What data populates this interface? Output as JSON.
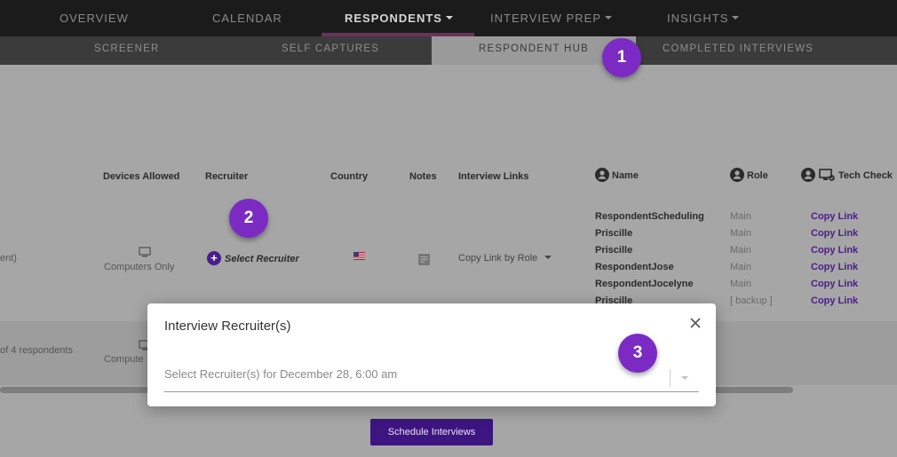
{
  "topnav": {
    "items": [
      {
        "label": "OVERVIEW"
      },
      {
        "label": "CALENDAR"
      },
      {
        "label": "RESPONDENTS"
      },
      {
        "label": "INTERVIEW PREP"
      },
      {
        "label": "INSIGHTS"
      }
    ],
    "active": "RESPONDENTS",
    "accent": "#6e2f5c"
  },
  "subnav": {
    "items": [
      {
        "label": "SCREENER"
      },
      {
        "label": "SELF CAPTURES"
      },
      {
        "label": "RESPONDENT HUB"
      },
      {
        "label": "COMPLETED INTERVIEWS"
      }
    ],
    "active": "RESPONDENT HUB"
  },
  "table": {
    "headers": {
      "devices": "Devices Allowed",
      "recruiter": "Recruiter",
      "country": "Country",
      "notes": "Notes",
      "interview_links": "Interview Links",
      "name": "Name",
      "role": "Role",
      "tech_check": "Tech Check"
    },
    "row1": {
      "left_fragment": "ent)",
      "devices": "Computers Only",
      "recruiter_action": "Select Recruiter",
      "country_flag": "flag-us-icon",
      "interview_links": "Copy Link by Role",
      "respondents": [
        {
          "name": "RespondentScheduling",
          "role": "Main",
          "link": "Copy Link"
        },
        {
          "name": "Priscille",
          "role": "Main",
          "link": "Copy Link"
        },
        {
          "name": "Priscille",
          "role": "Main",
          "link": "Copy Link"
        },
        {
          "name": "RespondentJose",
          "role": "Main",
          "link": "Copy Link"
        },
        {
          "name": "RespondentJocelyne",
          "role": "Main",
          "link": "Copy Link"
        },
        {
          "name": "Priscille",
          "role": "[ backup ]",
          "link": "Copy Link"
        }
      ]
    },
    "row2": {
      "left_fragment": "of 4 respondents",
      "devices": "Compute"
    }
  },
  "badges": [
    "1",
    "2",
    "3"
  ],
  "schedule_button": "Schedule Interviews",
  "modal": {
    "title": "Interview Recruiter(s)",
    "placeholder": "Select Recruiter(s) for December 28, 6:00 am"
  },
  "colors": {
    "badge": "#7b2bc4",
    "link": "#4a1e8a",
    "button": "#3d1580"
  }
}
